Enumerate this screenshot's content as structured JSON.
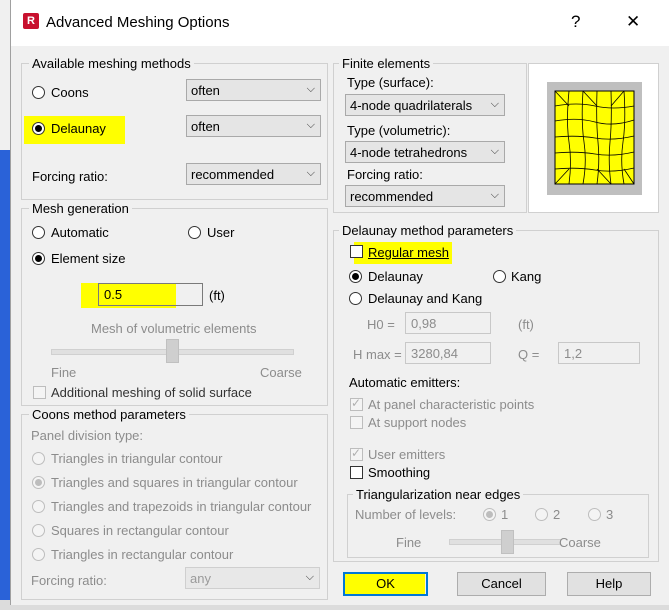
{
  "window": {
    "title": "Advanced Meshing Options",
    "help_glyph": "?",
    "close_glyph": "✕",
    "app_icon_letter": "R"
  },
  "available_methods": {
    "legend": "Available meshing methods",
    "coons_label": "Coons",
    "coons_select": "often",
    "delaunay_label": "Delaunay",
    "delaunay_select": "often",
    "forcing_label": "Forcing ratio:",
    "forcing_select": "recommended"
  },
  "mesh_generation": {
    "legend": "Mesh generation",
    "automatic": "Automatic",
    "user": "User",
    "element_size": "Element size",
    "element_size_value": "0.5",
    "unit": "(ft)",
    "volumetric_label": "Mesh of volumetric elements",
    "fine": "Fine",
    "coarse": "Coarse",
    "additional": "Additional meshing of solid surface"
  },
  "coons_params": {
    "legend": "Coons method parameters",
    "panel_division_type": "Panel division type:",
    "options": [
      "Triangles in triangular contour",
      "Triangles and squares in triangular contour",
      "Triangles and trapezoids in triangular contour",
      "Squares in rectangular contour",
      "Triangles in rectangular contour"
    ],
    "forcing_label": "Forcing ratio:",
    "forcing_select": "any"
  },
  "finite_elements": {
    "legend": "Finite elements",
    "type_surface_label": "Type (surface):",
    "type_surface_value": "4-node quadrilaterals",
    "type_volumetric_label": "Type (volumetric):",
    "type_volumetric_value": "4-node tetrahedrons",
    "forcing_label": "Forcing ratio:",
    "forcing_value": "recommended"
  },
  "delaunay_params": {
    "legend": "Delaunay method parameters",
    "regular_mesh": "Regular mesh",
    "delaunay": "Delaunay",
    "kang": "Kang",
    "delaunay_and_kang": "Delaunay and Kang",
    "h0_label": "H0 =",
    "h0_value": "0,98",
    "ft": "(ft)",
    "hmax_label": "H max =",
    "hmax_value": "3280,84",
    "q_label": "Q =",
    "q_value": "1,2",
    "auto_emitters": "Automatic emitters:",
    "at_panel": "At panel characteristic points",
    "at_support": "At support nodes",
    "user_emitters": "User emitters",
    "smoothing": "Smoothing"
  },
  "triangularization": {
    "legend": "Triangularization near edges",
    "levels_label": "Number of levels:",
    "level1": "1",
    "level2": "2",
    "level3": "3",
    "fine": "Fine",
    "coarse": "Coarse"
  },
  "buttons": {
    "ok": "OK",
    "cancel": "Cancel",
    "help": "Help"
  },
  "colors": {
    "highlight": "#ffff00",
    "mesh_fill": "#ffff00",
    "default_button_border": "#0078d7"
  }
}
